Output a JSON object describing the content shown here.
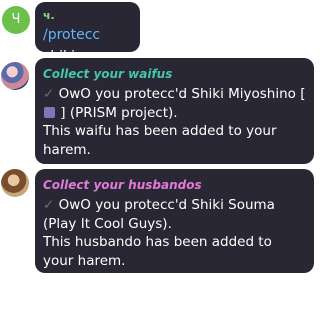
{
  "messages": [
    {
      "avatar_letter": "Ч",
      "sender": "ч.",
      "command": "/protecc",
      "argument": "shiki"
    },
    {
      "title": "Collect your waifus",
      "check": "✓",
      "line1_before_emoji": "OwO you protecc'd Shiki Miyoshino [",
      "line1_after_emoji": "] (PRISM project).",
      "line2": "This waifu has been added to your harem."
    },
    {
      "title": "Collect your husbandos",
      "check": "✓",
      "line1": "OwO you protecc'd Shiki Souma (Play It Cool Guys).",
      "line2": "This husbando has been added to your harem."
    }
  ],
  "colors": {
    "bubble_bg": "#2a2734",
    "link": "#5eb7ff",
    "waifu_title": "#43c6b0",
    "husbando_title": "#e07bd8",
    "sender": "#8ad58e"
  }
}
